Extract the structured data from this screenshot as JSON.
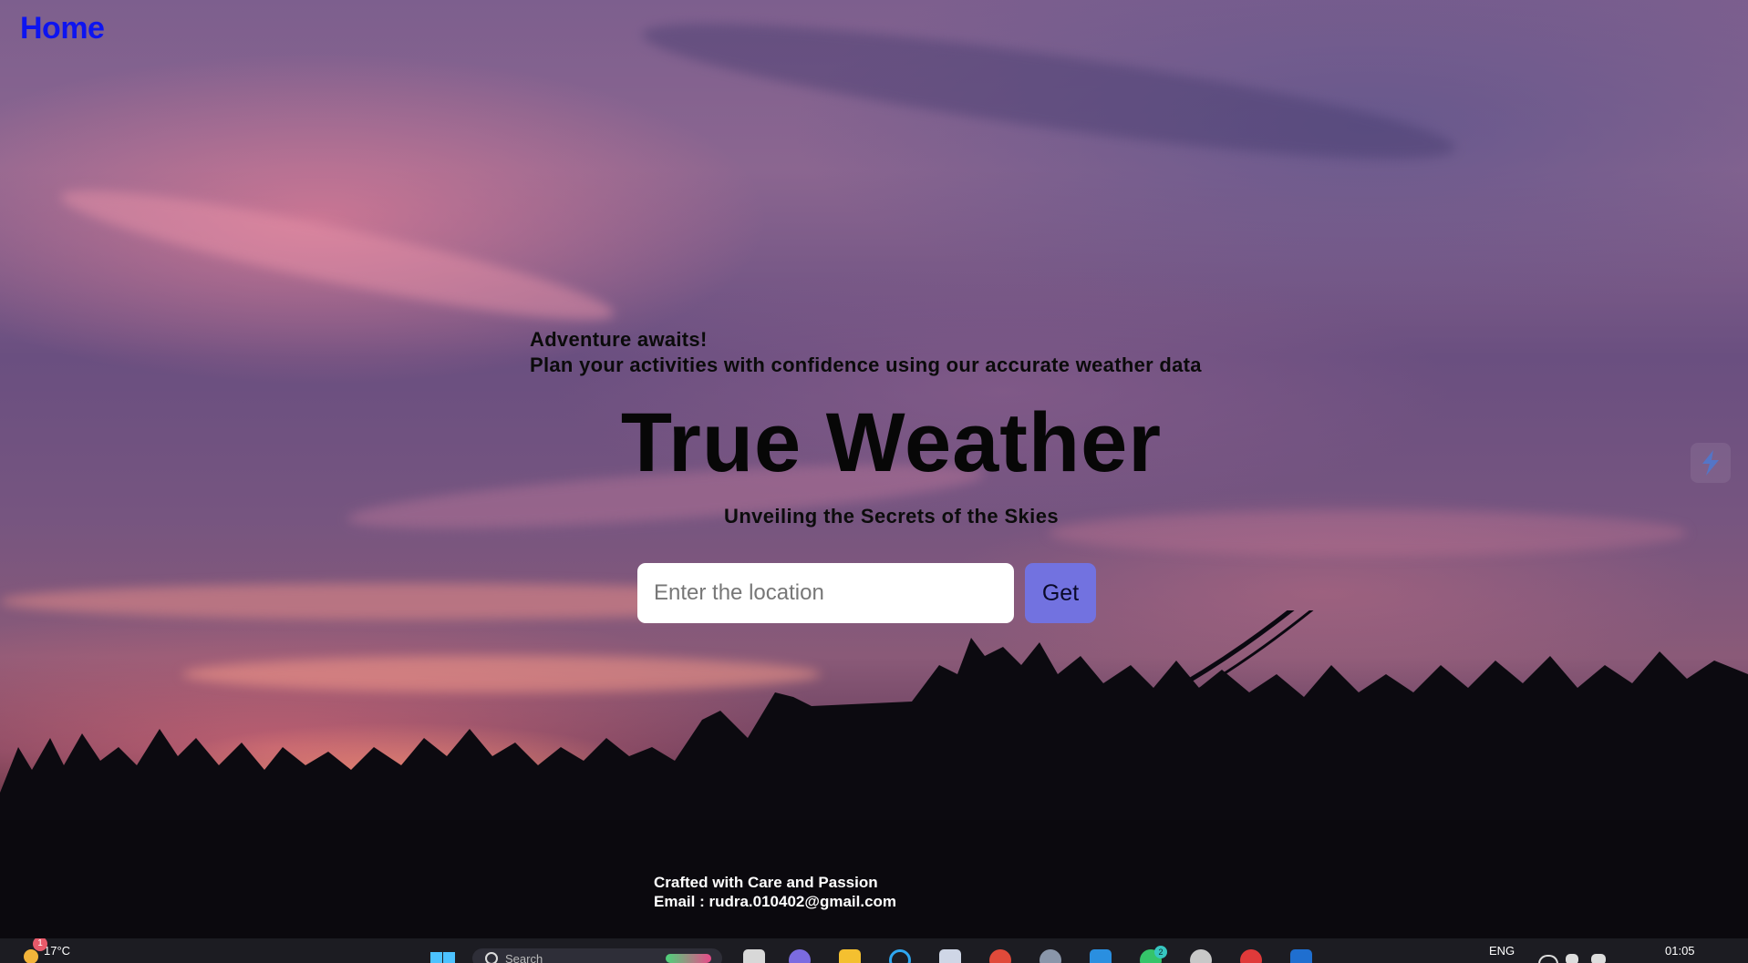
{
  "nav": {
    "home_label": "Home"
  },
  "hero": {
    "tagline_line1": "Adventure awaits!",
    "tagline_line2": "Plan your activities with confidence using our accurate weather data",
    "title": "True Weather",
    "subtitle": "Unveiling the Secrets of the Skies"
  },
  "search": {
    "placeholder": "Enter the location",
    "value": "",
    "button_label": "Get"
  },
  "footer": {
    "line1": "Crafted with Care and Passion",
    "line2": "Email : rudra.010402@gmail.com"
  },
  "taskbar": {
    "weather_temp": "17°C",
    "weather_notification_count": "1",
    "search_placeholder": "Search",
    "language": "ENG",
    "clock": "01:05",
    "app_badges": {
      "teams_count": "2"
    }
  },
  "colors": {
    "home_link": "#0d14f0",
    "get_button": "#7272e0",
    "taskbar_bg": "#1c1c22"
  },
  "icons": {
    "side_widget": "lightning-bolt-icon",
    "start": "windows-start-icon",
    "search": "search-icon"
  }
}
